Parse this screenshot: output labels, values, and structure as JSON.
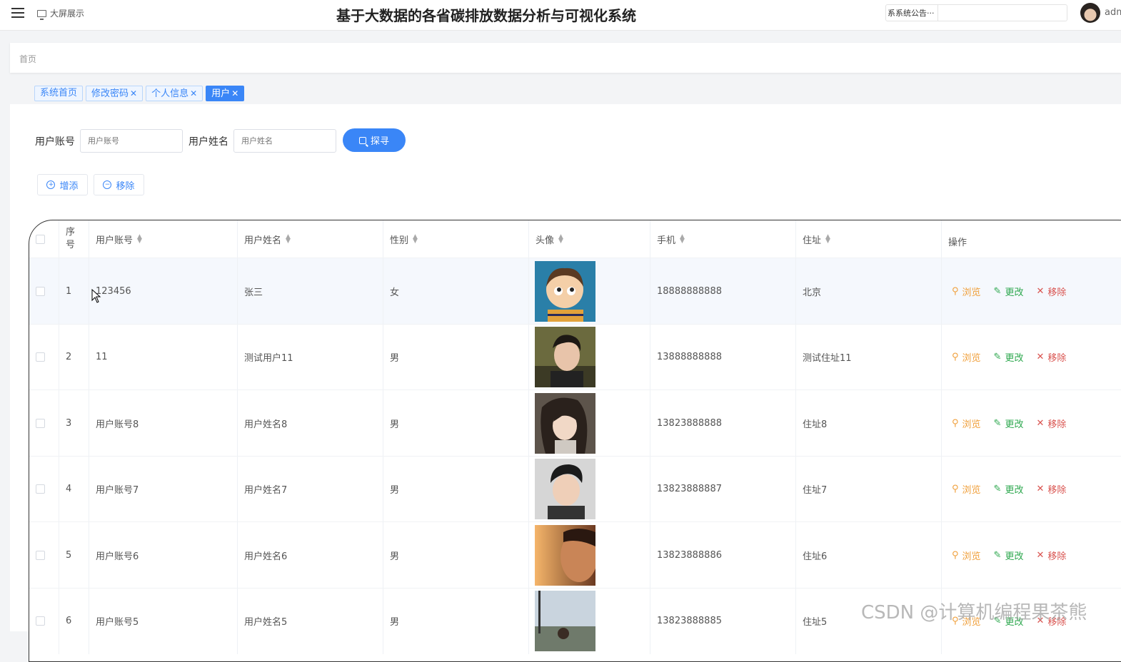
{
  "header": {
    "title": "基于大数据的各省碳排放数据分析与可视化系统",
    "bigscreen_label": "大屏展示",
    "notice_text": "系系统公告···",
    "user_label": "adm"
  },
  "breadcrumb": {
    "home": "首页"
  },
  "tabs": [
    {
      "label": "系统首页",
      "closable": false,
      "active": false
    },
    {
      "label": "修改密码",
      "closable": true,
      "active": false
    },
    {
      "label": "个人信息",
      "closable": true,
      "active": false
    },
    {
      "label": "用户",
      "closable": true,
      "active": true
    }
  ],
  "search": {
    "account_label": "用户账号",
    "account_placeholder": "用户账号",
    "name_label": "用户姓名",
    "name_placeholder": "用户姓名",
    "search_button": "探寻"
  },
  "actions": {
    "add": "增添",
    "remove": "移除"
  },
  "table": {
    "columns": {
      "index": "序号",
      "account": "用户账号",
      "name": "用户姓名",
      "gender": "性别",
      "avatar": "头像",
      "phone": "手机",
      "address": "住址",
      "ops": "操作"
    },
    "row_actions": {
      "view": "浏览",
      "edit": "更改",
      "delete": "移除"
    },
    "rows": [
      {
        "index": "1",
        "account": "123456",
        "name": "张三",
        "gender": "女",
        "phone": "18888888888",
        "address": "北京"
      },
      {
        "index": "2",
        "account": "11",
        "name": "测试用户11",
        "gender": "男",
        "phone": "13888888888",
        "address": "测试住址11"
      },
      {
        "index": "3",
        "account": "用户账号8",
        "name": "用户姓名8",
        "gender": "男",
        "phone": "13823888888",
        "address": "住址8"
      },
      {
        "index": "4",
        "account": "用户账号7",
        "name": "用户姓名7",
        "gender": "男",
        "phone": "13823888887",
        "address": "住址7"
      },
      {
        "index": "5",
        "account": "用户账号6",
        "name": "用户姓名6",
        "gender": "男",
        "phone": "13823888886",
        "address": "住址6"
      },
      {
        "index": "6",
        "account": "用户账号5",
        "name": "用户姓名5",
        "gender": "男",
        "phone": "13823888885",
        "address": "住址5"
      }
    ]
  },
  "watermark": "CSDN @计算机编程果茶熊",
  "colors": {
    "primary": "#3a86f7",
    "view": "#f0a03c",
    "edit": "#2ea84f",
    "delete": "#d9534f"
  }
}
